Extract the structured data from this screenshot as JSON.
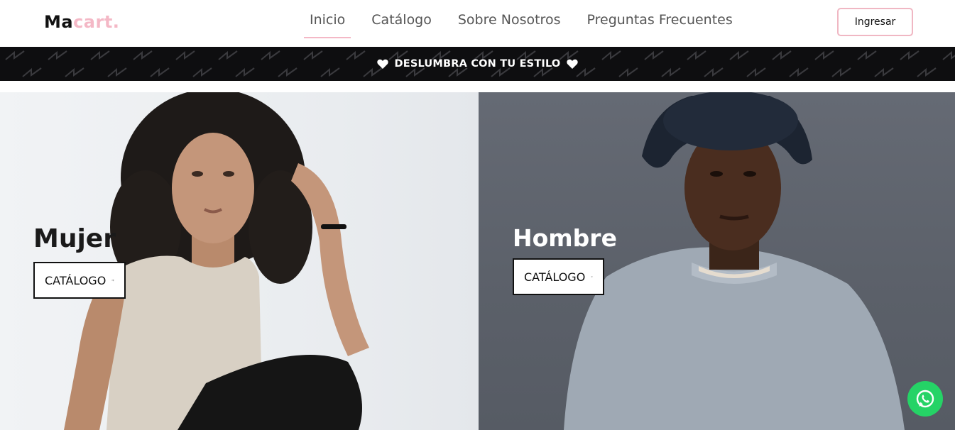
{
  "brand": {
    "part1": "Ma",
    "part2": "cart."
  },
  "nav": {
    "items": [
      {
        "label": "Inicio",
        "active": true
      },
      {
        "label": "Catálogo",
        "active": false
      },
      {
        "label": "Sobre Nosotros",
        "active": false
      },
      {
        "label": "Preguntas Frecuentes",
        "active": false
      }
    ],
    "login_label": "Ingresar"
  },
  "banner": {
    "text": "DESLUMBRA CON TU ESTILO"
  },
  "hero": {
    "women": {
      "title": "Mujer",
      "button_label": "CATÁLOGO"
    },
    "men": {
      "title": "Hombre",
      "button_label": "CATÁLOGO"
    }
  },
  "icons": {
    "heart": "heart-icon",
    "arrow": "arrow-right-icon",
    "whatsapp": "whatsapp-icon"
  },
  "colors": {
    "accent_pink": "#f4b8c6",
    "banner_bg": "#0e0e10",
    "whatsapp_green": "#25d366"
  }
}
